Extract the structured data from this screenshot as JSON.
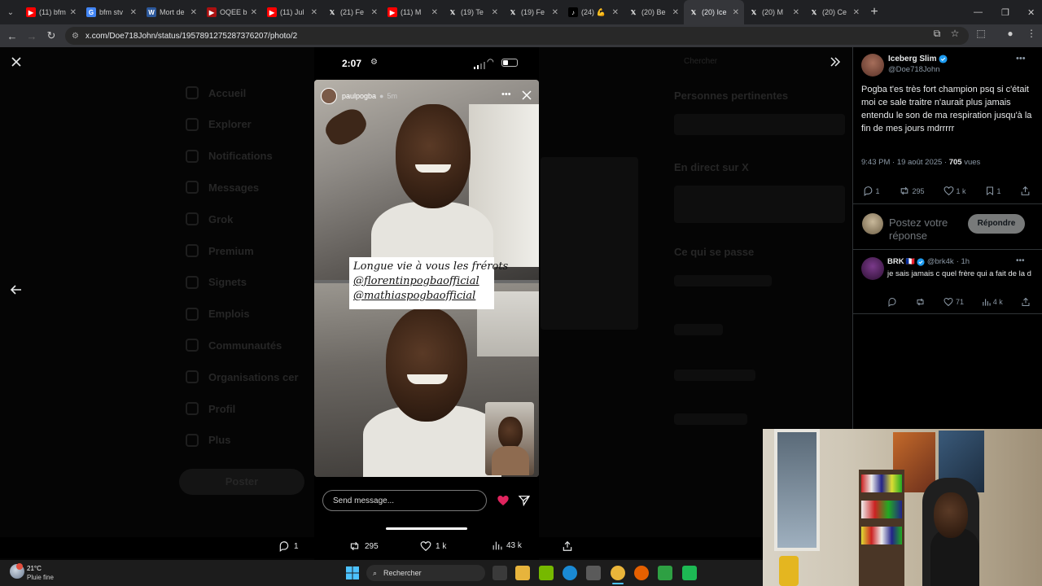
{
  "browser": {
    "tabs": [
      {
        "label": "(11) bfm",
        "icon": "youtube-icon",
        "color": "#ff0000"
      },
      {
        "label": "bfm stv",
        "icon": "google-icon",
        "color": "#4285f4"
      },
      {
        "label": "Mort de",
        "icon": "word-icon",
        "color": "#2b579a"
      },
      {
        "label": "OQEE b",
        "icon": "oqee-icon",
        "color": "#aa1111"
      },
      {
        "label": "(11) Jul",
        "icon": "youtube-icon",
        "color": "#ff0000"
      },
      {
        "label": "(21) Fe",
        "icon": "x-icon",
        "color": "#000000"
      },
      {
        "label": "(11) M",
        "icon": "youtube-icon",
        "color": "#ff0000"
      },
      {
        "label": "(19) Te",
        "icon": "x-icon",
        "color": "#000000"
      },
      {
        "label": "(19) Fe",
        "icon": "x-icon",
        "color": "#000000"
      },
      {
        "label": "(24) 💪",
        "icon": "tiktok-icon",
        "color": "#000000"
      },
      {
        "label": "(20) Be",
        "icon": "x-icon",
        "color": "#000000"
      },
      {
        "label": "(20) Ice",
        "icon": "x-icon",
        "color": "#000000",
        "active": true
      },
      {
        "label": "(20) M",
        "icon": "x-icon",
        "color": "#000000"
      },
      {
        "label": "(20) Ce",
        "icon": "x-icon",
        "color": "#000000"
      }
    ],
    "url": "x.com/Doe718John/status/1957891275287376207/photo/2"
  },
  "background_nav": [
    "Accueil",
    "Explorer",
    "Notifications",
    "Messages",
    "Grok",
    "Premium",
    "Signets",
    "Emplois",
    "Communautés",
    "Organisations cer",
    "Profil",
    "Plus"
  ],
  "background_post_button": "Poster",
  "background_right": {
    "search": "Chercher",
    "relevant": "Personnes pertinentes",
    "live": "En direct sur X",
    "happening": "Ce qui se passe"
  },
  "phone": {
    "time": "2:07",
    "story_user": "paulpogba",
    "story_age": "5m",
    "caption_line1": "Longue vie à vous les frérots",
    "caption_line2": "@florentinpogbaofficial",
    "caption_line3": "@mathiaspogbaofficial",
    "message_placeholder": "Send message..."
  },
  "media_actions": {
    "replies": "1",
    "reposts": "295",
    "likes": "1 k",
    "views": "43 k"
  },
  "tweet": {
    "author_name": "Iceberg Slim",
    "author_handle": "@Doe718John",
    "text": "Pogba t'es très fort champion psq si c'était moi ce sale traitre n'aurait plus jamais entendu le son de ma respiration jusqu'à la fin de mes jours mdrrrrr",
    "time": "9:43 PM · 19 août 2025 · ",
    "views_count": "705",
    "views_label": " vues",
    "replies": "1",
    "reposts": "295",
    "likes": "1 k",
    "bookmarks": "1",
    "reply_placeholder": "Postez votre réponse",
    "reply_button": "Répondre"
  },
  "reply": {
    "author_name": "BRK",
    "flag": "🇫🇷",
    "author_handle": "@brk4k",
    "age": "· 1h",
    "text": "je sais jamais c quel frère qui a fait de la d",
    "likes": "71",
    "views": "4 k"
  },
  "taskbar": {
    "temperature": "21°C",
    "weather": "Pluie fine",
    "search": "Rechercher"
  },
  "colors": {
    "verified": "#1d9bf0",
    "like_heart": "#e0245e",
    "reply_button_bg": "#787a7a"
  }
}
